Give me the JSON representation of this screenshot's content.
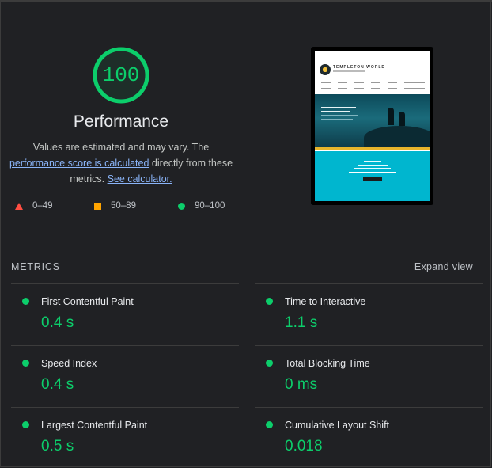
{
  "gauge": {
    "score": "100",
    "color": "#0cce6b"
  },
  "performance": {
    "title": "Performance",
    "desc_1": "Values are estimated and may vary. The",
    "desc_link": "performance score is calculated",
    "desc_2": "directly from these metrics.",
    "calc_link": "See calculator."
  },
  "legend": [
    {
      "range": "0–49",
      "icon": "red-triangle-icon",
      "color": "#ff4e42"
    },
    {
      "range": "50–89",
      "icon": "orange-square-icon",
      "color": "#ffa400"
    },
    {
      "range": "90–100",
      "icon": "green-circle-icon",
      "color": "#0cce6b"
    }
  ],
  "thumbnail": {
    "brand": "TEMPLETON WORLD"
  },
  "metrics": {
    "header": "METRICS",
    "expand_label": "Expand view",
    "items": [
      {
        "name": "First Contentful Paint",
        "value": "0.4 s"
      },
      {
        "name": "Time to Interactive",
        "value": "1.1 s"
      },
      {
        "name": "Speed Index",
        "value": "0.4 s"
      },
      {
        "name": "Total Blocking Time",
        "value": "0 ms"
      },
      {
        "name": "Largest Contentful Paint",
        "value": "0.5 s"
      },
      {
        "name": "Cumulative Layout Shift",
        "value": "0.018"
      }
    ]
  }
}
